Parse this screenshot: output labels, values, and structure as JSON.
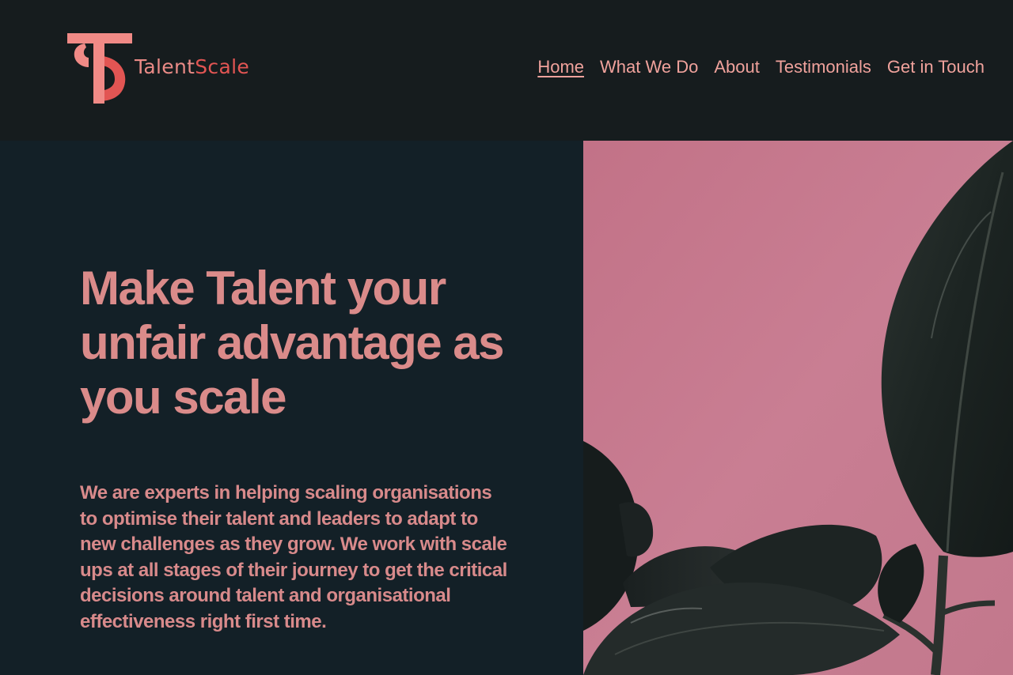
{
  "brand": {
    "name_part1": "Talent",
    "name_part2": "Scale",
    "logo_icon": "ts-monogram-icon",
    "colors": {
      "primary_pink": "#f08a86",
      "accent_red": "#e25553",
      "text_pink": "#da8b8a"
    }
  },
  "nav": {
    "items": [
      {
        "label": "Home",
        "active": true
      },
      {
        "label": "What We Do",
        "active": false
      },
      {
        "label": "About",
        "active": false
      },
      {
        "label": "Testimonials",
        "active": false
      },
      {
        "label": "Get in Touch",
        "active": false
      }
    ]
  },
  "hero": {
    "title": "Make Talent your unfair advantage as you scale",
    "body": "We are experts in helping scaling organisations to optimise their talent and leaders to adapt to new challenges as they grow. We work with scale ups at all stages of their journey to get the critical decisions around talent and organisational effectiveness right first time.",
    "image": "rubber-plant-leaves-on-pink-wall"
  },
  "theme": {
    "header_bg": "#161c1e",
    "hero_bg": "#132027",
    "photo_bg": "#c67a8f"
  }
}
